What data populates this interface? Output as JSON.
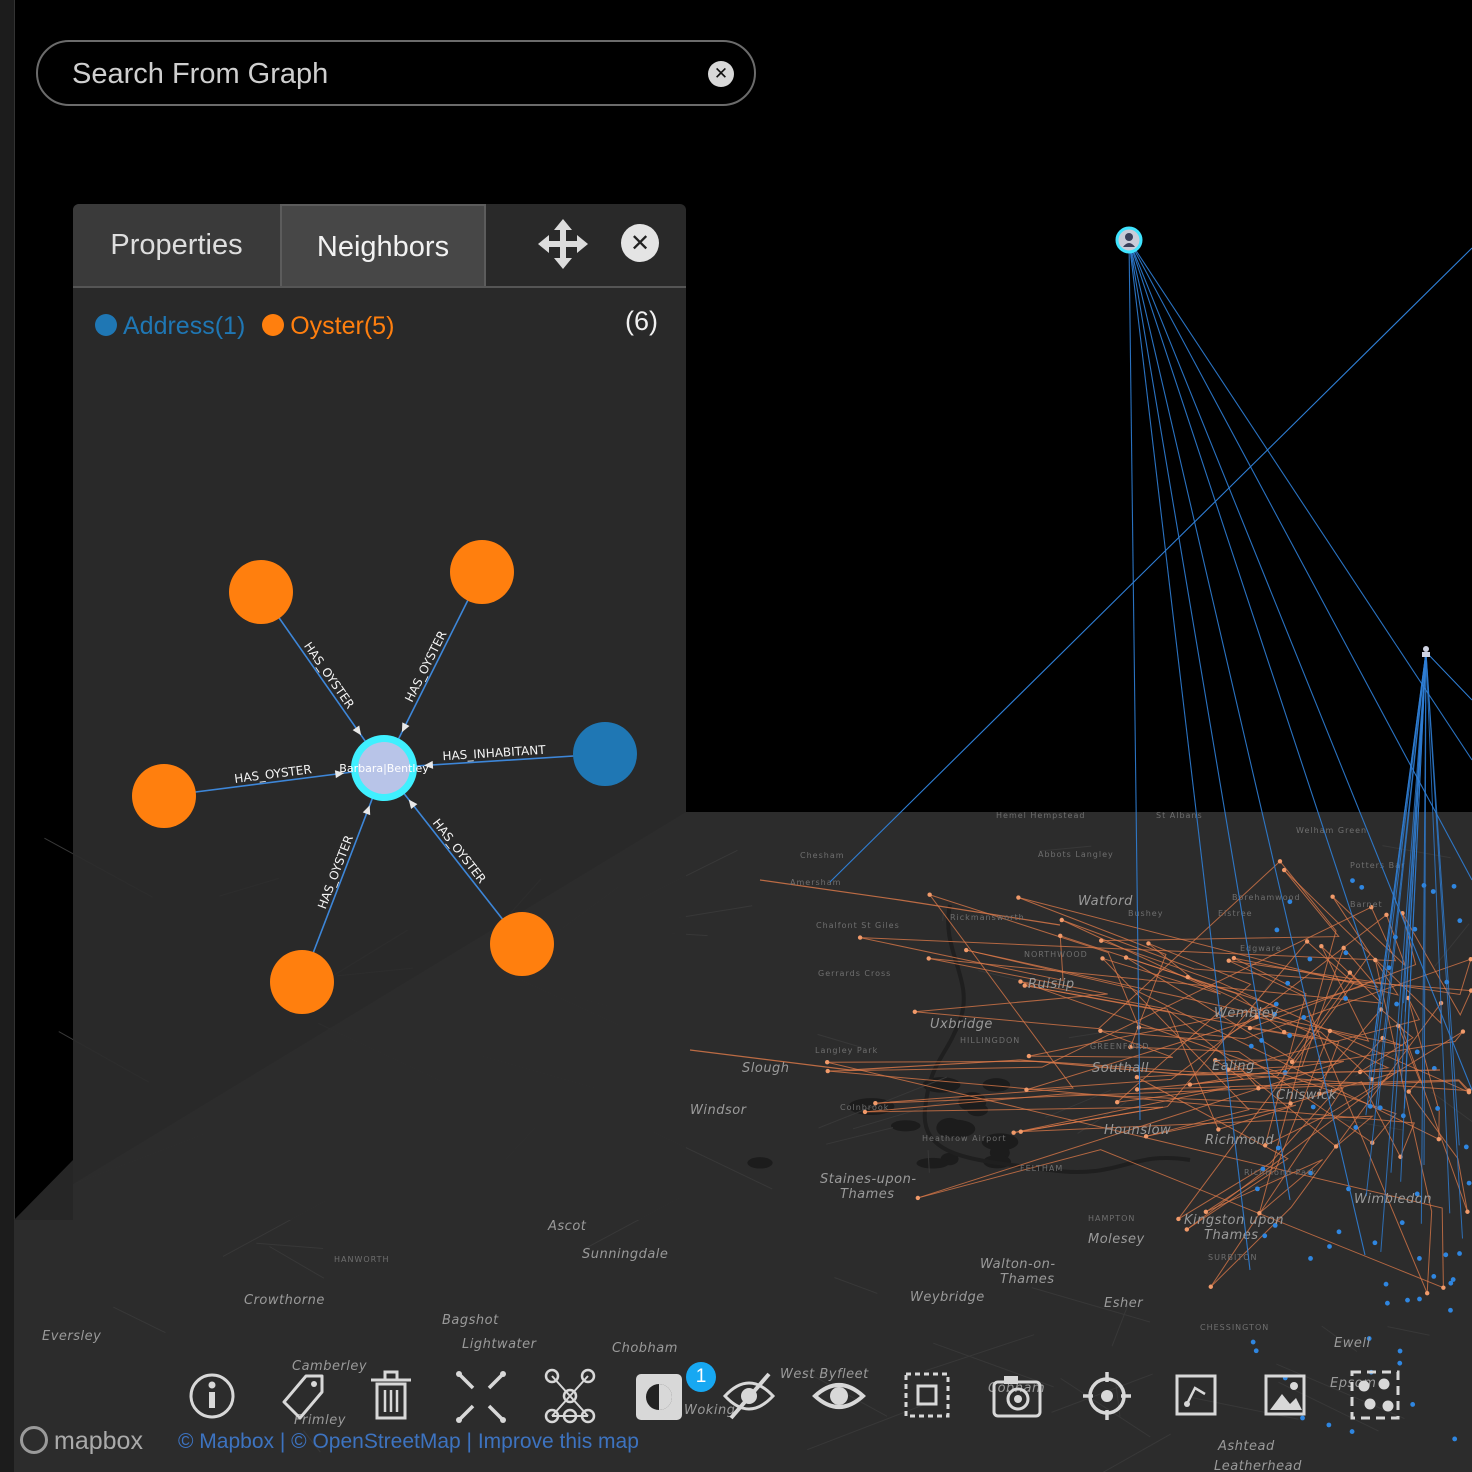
{
  "search": {
    "placeholder": "Search From Graph",
    "clear_icon": "close-circle-icon"
  },
  "panel": {
    "tabs": [
      {
        "label": "Properties",
        "active": false
      },
      {
        "label": "Neighbors",
        "active": true
      }
    ],
    "move_icon": "move-arrows-icon",
    "close_icon": "close-circle-icon",
    "legend": [
      {
        "label": "Address(1)",
        "color": "#1f77b4"
      },
      {
        "label": "Oyster(5)",
        "color": "#ff7f0e"
      }
    ],
    "count": "(6)",
    "graph": {
      "center_label": "Barbara|Bentley",
      "center_color": "#b8c4e8",
      "center_ring_color": "#3ff0ff",
      "edges": [
        "HAS_OYSTER",
        "HAS_OYSTER",
        "HAS_OYSTER",
        "HAS_OYSTER",
        "HAS_OYSTER",
        "HAS_INHABITANT"
      ]
    }
  },
  "map": {
    "labels": [
      "Chesham",
      "Amersham",
      "Watford",
      "Bushey",
      "Borehamwood",
      "Edgware",
      "Ruislip",
      "Uxbridge",
      "HILLINGDON",
      "Gerrards Cross",
      "Langley Park",
      "Slough",
      "Windsor",
      "Colnbrook",
      "Heathrow Airport",
      "Southall",
      "Ealing",
      "Hounslow",
      "Richmond",
      "Chiswick",
      "Staines-upon-Thames",
      "FELTHAM",
      "HAMPTON",
      "Molesey",
      "Kingston upon Thames",
      "SURBITON",
      "Walton-on-Thames",
      "Weybridge",
      "Esher",
      "CHESSINGTON",
      "Ewell",
      "Ascot",
      "Sunningdale",
      "Bagshot",
      "Lightwater",
      "Chobham",
      "Camberley",
      "Frimley",
      "Crowthorne",
      "Eversley",
      "HANWORTH",
      "West Byfleet",
      "Woking",
      "Wembley",
      "Wimbledon",
      "Richmond Park",
      "Ashtead",
      "Leatherhead",
      "St Albans",
      "Potters Bar",
      "Barnet",
      "Welham Green",
      "Hemel Hempstead",
      "Abbots Langley",
      "Rickmansworth",
      "Chalfont St Giles",
      "GREENFORD",
      "NORTHWOOD",
      "Elstree",
      "Cobham",
      "Epsom"
    ],
    "label_color": "#8a8a8a",
    "route_color": "#e07b4a",
    "link_color": "#2f7fd6"
  },
  "toolbar": {
    "items": [
      {
        "icon": "info-icon"
      },
      {
        "icon": "tag-icon"
      },
      {
        "icon": "trash-icon"
      },
      {
        "icon": "expand-icon"
      },
      {
        "icon": "graph-layout-icon"
      },
      {
        "icon": "contrast-toggle-icon"
      },
      {
        "icon": "eye-off-icon"
      },
      {
        "icon": "eye-icon"
      },
      {
        "icon": "select-area-icon"
      },
      {
        "icon": "camera-icon"
      },
      {
        "icon": "crosshair-icon"
      },
      {
        "icon": "edit-path-icon"
      },
      {
        "icon": "image-icon"
      },
      {
        "icon": "group-nodes-icon"
      }
    ],
    "badge": "1"
  },
  "attribution": {
    "logo_text": "mapbox",
    "links": [
      "© Mapbox",
      "© OpenStreetMap",
      "Improve this map"
    ]
  }
}
